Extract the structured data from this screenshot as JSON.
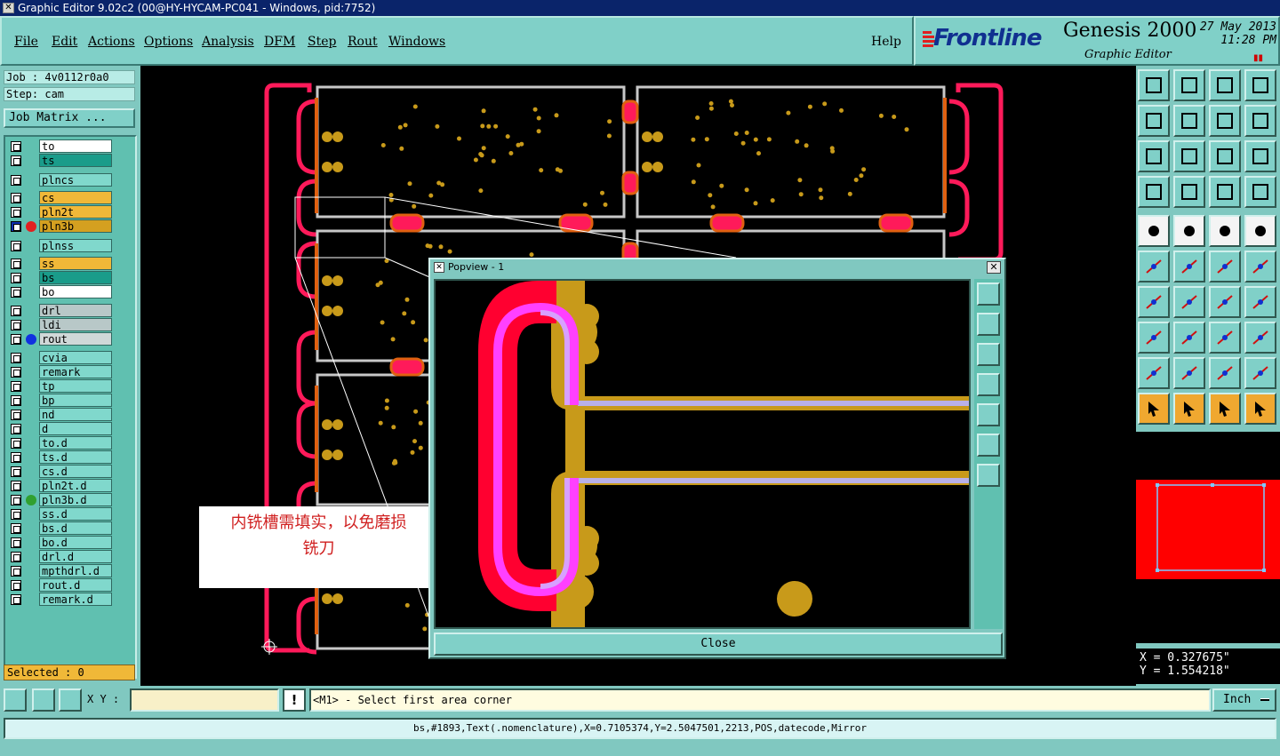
{
  "window": {
    "title": "Graphic Editor 9.02c2 (00@HY-HYCAM-PC041 - Windows, pid:7752)"
  },
  "menu": {
    "items": [
      {
        "label": "File"
      },
      {
        "label": "Edit"
      },
      {
        "label": "Actions"
      },
      {
        "label": "Options"
      },
      {
        "label": "Analysis"
      },
      {
        "label": "DFM"
      },
      {
        "label": "Step"
      },
      {
        "label": "Rout"
      },
      {
        "label": "Windows"
      }
    ],
    "help": "Help"
  },
  "brand": {
    "logo": "Frontline",
    "product": "Genesis 2000",
    "subtitle": "Graphic Editor",
    "date": "27 May 2013",
    "time": "11:28 PM"
  },
  "job": {
    "job_label": "Job : 4v0112r0a0",
    "step_label": "Step: cam",
    "job_matrix": "Job Matrix ..."
  },
  "layers": [
    {
      "name": "to",
      "color": "#ffffff",
      "dot": ""
    },
    {
      "name": "ts",
      "color": "#1a9c8a",
      "dot": ""
    },
    {
      "name": "plncs",
      "color": "#80d8cc",
      "dot": ""
    },
    {
      "name": "cs",
      "color": "#f0b838",
      "dot": ""
    },
    {
      "name": "pln2t",
      "color": "#f0b838",
      "dot": ""
    },
    {
      "name": "pln3b",
      "color": "#d4a020",
      "dot": "#e02020",
      "active": true
    },
    {
      "name": "plnss",
      "color": "#80d8cc",
      "dot": ""
    },
    {
      "name": "ss",
      "color": "#f0b838",
      "dot": ""
    },
    {
      "name": "bs",
      "color": "#1a9c8a",
      "dot": ""
    },
    {
      "name": "bo",
      "color": "#ffffff",
      "dot": ""
    },
    {
      "name": "drl",
      "color": "#b8c8c8",
      "dot": ""
    },
    {
      "name": "ldi",
      "color": "#b8c8c8",
      "dot": ""
    },
    {
      "name": "rout",
      "color": "#d0d8d8",
      "dot": "#1030e0"
    },
    {
      "name": "cvia",
      "color": "#80d8cc",
      "dot": ""
    },
    {
      "name": "remark",
      "color": "#80d8cc",
      "dot": ""
    },
    {
      "name": "tp",
      "color": "#80d8cc",
      "dot": ""
    },
    {
      "name": "bp",
      "color": "#80d8cc",
      "dot": ""
    },
    {
      "name": "nd",
      "color": "#80d8cc",
      "dot": ""
    },
    {
      "name": "d",
      "color": "#80d8cc",
      "dot": ""
    },
    {
      "name": "to.d",
      "color": "#80d8cc",
      "dot": ""
    },
    {
      "name": "ts.d",
      "color": "#80d8cc",
      "dot": ""
    },
    {
      "name": "cs.d",
      "color": "#80d8cc",
      "dot": ""
    },
    {
      "name": "pln2t.d",
      "color": "#80d8cc",
      "dot": ""
    },
    {
      "name": "pln3b.d",
      "color": "#80d8cc",
      "dot": "#30a030"
    },
    {
      "name": "ss.d",
      "color": "#80d8cc",
      "dot": ""
    },
    {
      "name": "bs.d",
      "color": "#80d8cc",
      "dot": ""
    },
    {
      "name": "bo.d",
      "color": "#80d8cc",
      "dot": ""
    },
    {
      "name": "drl.d",
      "color": "#80d8cc",
      "dot": ""
    },
    {
      "name": "mpthdrl.d",
      "color": "#80d8cc",
      "dot": ""
    },
    {
      "name": "rout.d",
      "color": "#80d8cc",
      "dot": ""
    },
    {
      "name": "remark.d",
      "color": "#80d8cc",
      "dot": ""
    }
  ],
  "selected": "Selected : 0",
  "popup": {
    "title": "Popview - 1",
    "close_label": "Close"
  },
  "note": {
    "line1": "内铣槽需填实，以免磨损",
    "line2": "铣刀"
  },
  "coords": {
    "x": "X = 0.327675\"",
    "y": "Y = 1.554218\""
  },
  "bottom": {
    "xy_label": "X Y :",
    "xy_value": "",
    "excl": "!",
    "prompt": "<M1> - Select first area corner",
    "unit": "Inch"
  },
  "status": "bs,#1893,Text(.nomenclature),X=0.7105374,Y=2.5047501,2213,POS,datecode,Mirror",
  "colors": {
    "background": "#80c8c0",
    "canvas": "#000000",
    "profile": "#ff1a5a",
    "copper": "#c89a1a",
    "outline": "#c8c8c8"
  }
}
